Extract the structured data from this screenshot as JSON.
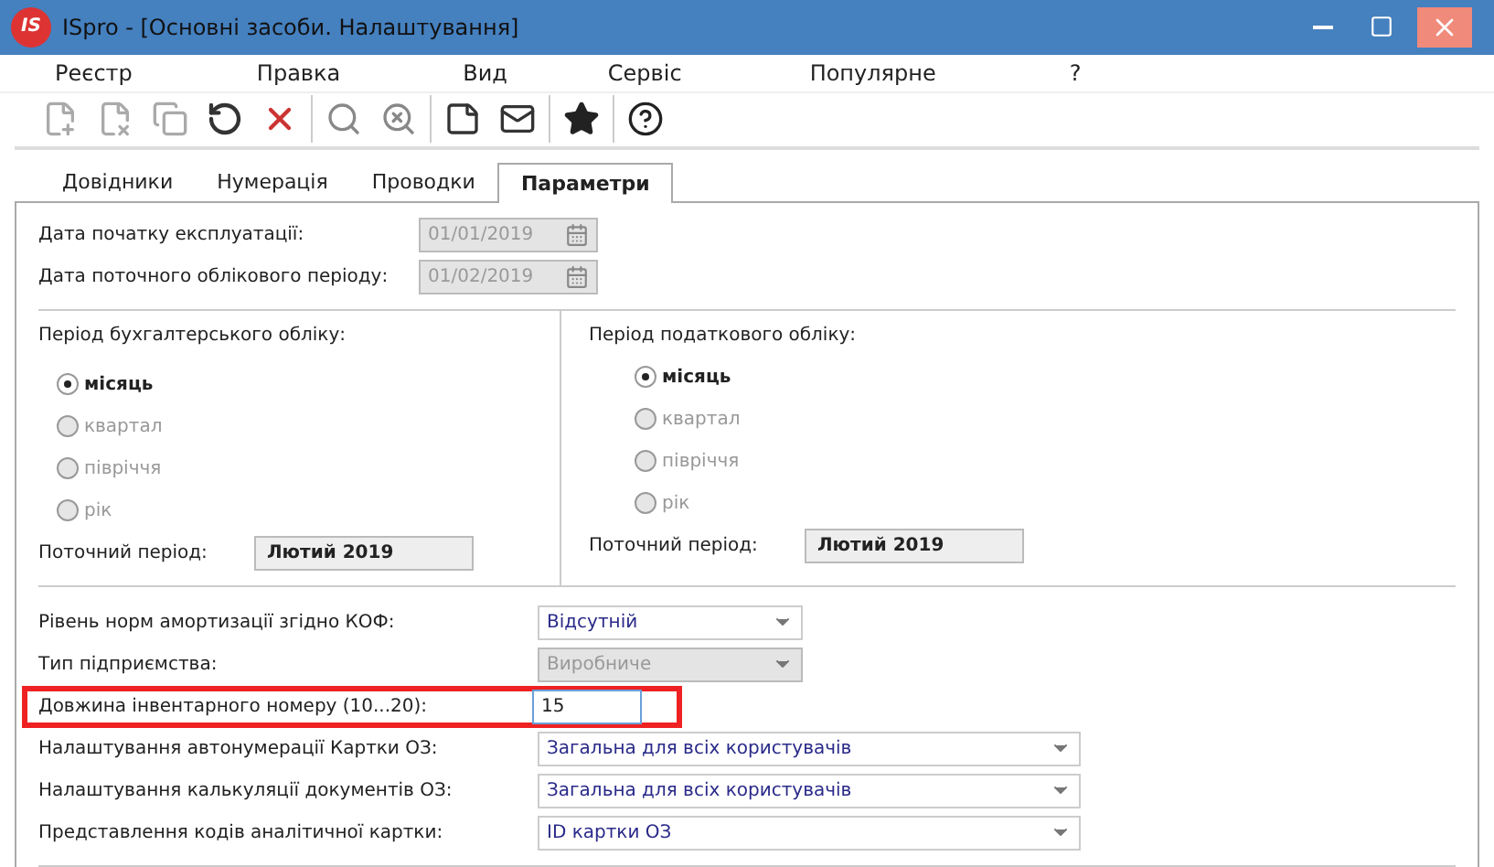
{
  "window": {
    "title": "ISpro - [Основні засоби. Налаштування]",
    "logo": "IS"
  },
  "menu": [
    "Реєстр",
    "Правка",
    "Вид",
    "Сервіс",
    "Популярне",
    "?"
  ],
  "tabs": [
    {
      "label": "Довідники",
      "selected": false
    },
    {
      "label": "Нумерація",
      "selected": false
    },
    {
      "label": "Проводки",
      "selected": false
    },
    {
      "label": "Параметри",
      "selected": true
    }
  ],
  "dates": [
    {
      "label": "Дата початку експлуатації:",
      "value": "01/01/2019",
      "disabled": true
    },
    {
      "label": "Дата поточного облікового періоду:",
      "value": "01/02/2019",
      "disabled": true
    }
  ],
  "periods": [
    {
      "title": "Період бухгалтерського обліку:",
      "options": [
        {
          "label": "місяць",
          "selected": true,
          "disabled": false
        },
        {
          "label": "квартал",
          "selected": false,
          "disabled": true
        },
        {
          "label": "півріччя",
          "selected": false,
          "disabled": true
        },
        {
          "label": "рік",
          "selected": false,
          "disabled": true
        }
      ],
      "current_label": "Поточний період:",
      "current_value": "Лютий 2019"
    },
    {
      "title": "Період податкового обліку:",
      "options": [
        {
          "label": "місяць",
          "selected": true,
          "disabled": false
        },
        {
          "label": "квартал",
          "selected": false,
          "disabled": true
        },
        {
          "label": "півріччя",
          "selected": false,
          "disabled": true
        },
        {
          "label": "рік",
          "selected": false,
          "disabled": true
        }
      ],
      "current_label": "Поточний період:",
      "current_value": "Лютий 2019"
    }
  ],
  "settings": [
    {
      "kind": "select",
      "label": "Рівень норм амортизації згідно КОФ:",
      "value": "Відсутній",
      "disabled": false,
      "wide": false,
      "highlighted": false
    },
    {
      "kind": "select",
      "label": "Тип підприємства:",
      "value": "Виробниче",
      "disabled": true,
      "wide": false,
      "highlighted": false
    },
    {
      "kind": "input",
      "label": "Довжина інвентарного номеру (10...20):",
      "value": "15",
      "highlighted": true
    },
    {
      "kind": "select",
      "label": "Налаштування автонумерації Картки ОЗ:",
      "value": "Загальна для всіх користувачів",
      "disabled": false,
      "wide": true,
      "highlighted": false
    },
    {
      "kind": "select",
      "label": "Налаштування калькуляції документів ОЗ:",
      "value": "Загальна для всіх користувачів",
      "disabled": false,
      "wide": true,
      "highlighted": false
    },
    {
      "kind": "select",
      "label": "Представлення кодів аналітичної картки:",
      "value": "ID картки ОЗ",
      "disabled": false,
      "wide": true,
      "highlighted": false
    }
  ]
}
